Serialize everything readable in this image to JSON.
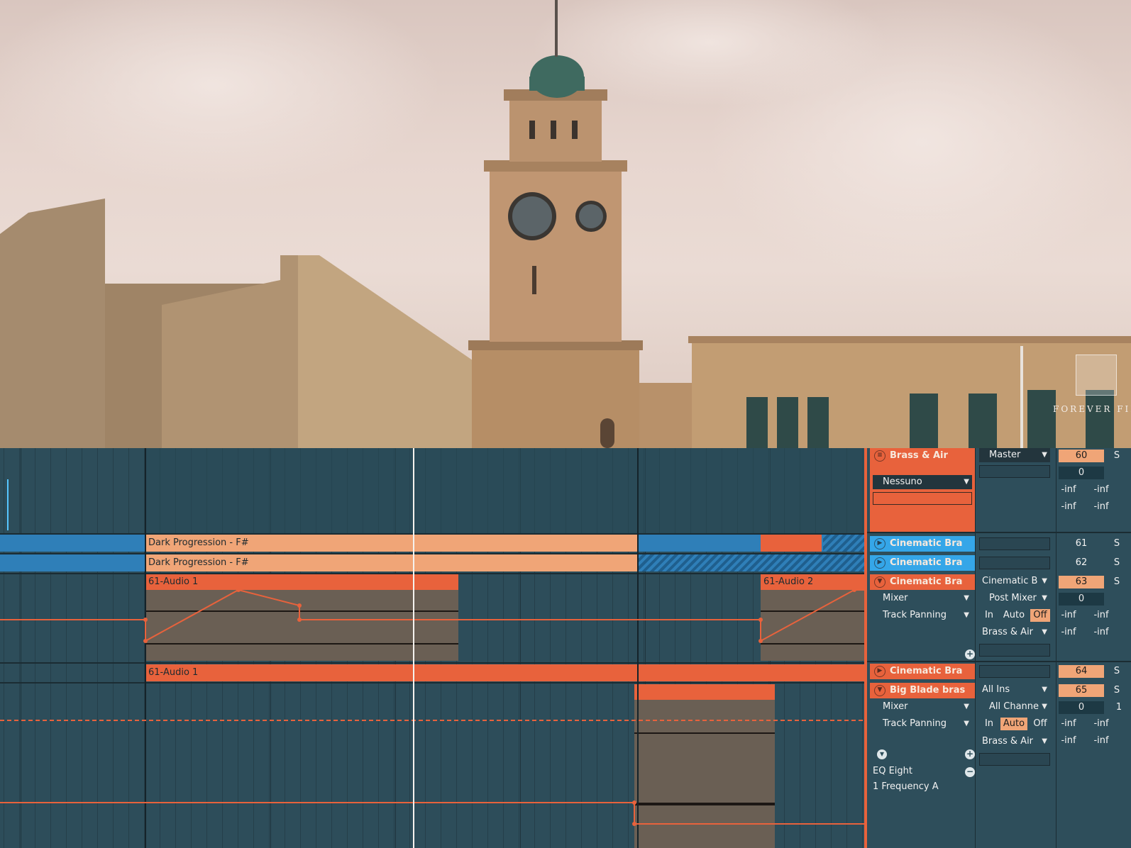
{
  "watermark": {
    "text": "FOREVER FIL"
  },
  "arrangement": {
    "clips": [
      {
        "id": "dark1",
        "label": "Dark Progression - F#"
      },
      {
        "id": "dark2",
        "label": "Dark Progression - F#"
      },
      {
        "id": "audio1",
        "label": "61-Audio 1"
      },
      {
        "id": "audio2",
        "label": "61-Audio 2"
      },
      {
        "id": "audio1b",
        "label": "61-Audio 1"
      }
    ]
  },
  "mixer": {
    "group": {
      "name": "Brass & Air",
      "output": "Master",
      "volume": "60",
      "pan": "0",
      "solo": "S",
      "input_select": "Nessuno",
      "meter_l1": "-inf",
      "meter_r1": "-inf",
      "meter_l2": "-inf",
      "meter_r2": "-inf"
    },
    "tracks": [
      {
        "name": "Cinematic Bra",
        "volume": "61",
        "solo": "S"
      },
      {
        "name": "Cinematic Bra",
        "volume": "62",
        "solo": "S"
      },
      {
        "name": "Cinematic Bra",
        "output": "Cinematic B",
        "volume": "63",
        "solo": "S",
        "device": "Mixer",
        "param": "Track Panning",
        "input_ch": "Post Mixer",
        "pan": "0",
        "monitor": [
          "In",
          "Auto",
          "Off"
        ],
        "monitor_active": "Off",
        "send": "Brass & Air",
        "meters": [
          "-inf",
          "-inf",
          "-inf",
          "-inf"
        ]
      },
      {
        "name": "Cinematic Bra",
        "volume": "64",
        "solo": "S"
      },
      {
        "name": "Big Blade bras",
        "input": "All Ins",
        "volume": "65",
        "solo": "S",
        "device": "Mixer",
        "param": "Track Panning",
        "input_ch": "All Channe",
        "pan": "0",
        "pan_extra": "1",
        "monitor": [
          "In",
          "Auto",
          "Off"
        ],
        "monitor_active": "Auto",
        "send": "Brass & Air",
        "meters": [
          "-inf",
          "-inf",
          "-inf",
          "-inf"
        ]
      }
    ],
    "device_chain": {
      "device": "EQ Eight",
      "param": "1 Frequency A"
    }
  }
}
